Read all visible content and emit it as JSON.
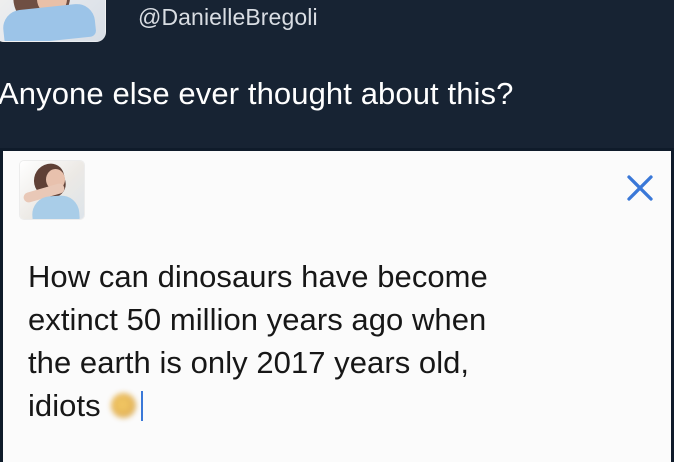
{
  "top": {
    "handle": "@DanielleBregoli",
    "question": "Anyone else ever thought about this?"
  },
  "card": {
    "tweet_lines": [
      "How can dinosaurs have become",
      "extinct 50 million years ago when",
      "the earth is only 2017 years old,",
      "idiots"
    ],
    "close_icon": "close-icon",
    "emoji_icon": "blurred-emoji-icon"
  },
  "colors": {
    "dark_background": "#172333",
    "card_background": "#fbfbfb",
    "text_dark": "#171717",
    "text_light": "#ffffff",
    "handle_text": "#d9dde3",
    "accent_blue": "#3a78d8"
  }
}
